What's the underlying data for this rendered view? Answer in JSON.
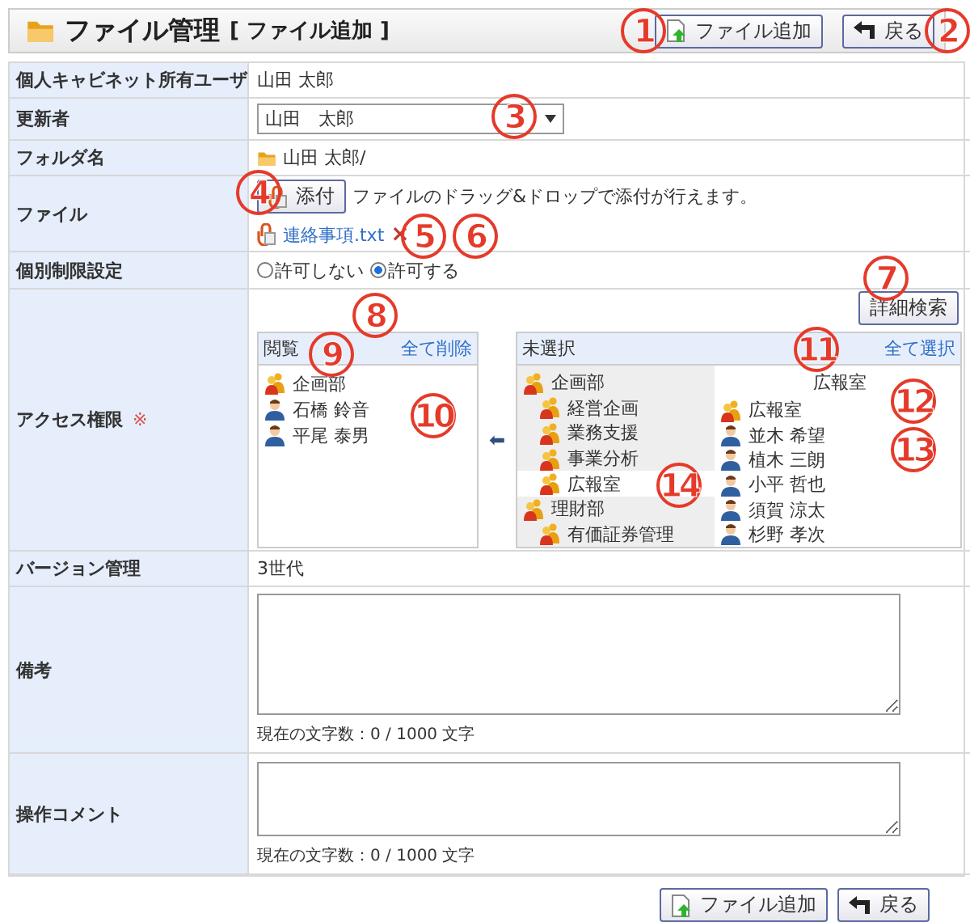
{
  "header": {
    "title": "ファイル管理",
    "subtitle": "[ ファイル追加 ]",
    "buttons": [
      {
        "kind": "add",
        "label": "ファイル追加"
      },
      {
        "kind": "back",
        "label": "戻る"
      }
    ]
  },
  "rows": [
    {
      "kind": "text",
      "label": "個人キャビネット所有ユーザ",
      "value": "山田 太郎"
    },
    {
      "kind": "select",
      "label": "更新者",
      "value": "山田　太郎"
    },
    {
      "kind": "folder",
      "label": "フォルダ名",
      "value": "山田 太郎/"
    },
    {
      "kind": "file",
      "label": "ファイル",
      "button": "添付",
      "hint": "ファイルのドラッグ&ドロップで添付が行えます。",
      "file": "連絡事項.txt",
      "remove": "×"
    },
    {
      "kind": "radio",
      "label": "個別制限設定",
      "options": [
        {
          "label": "許可しない",
          "selected": false
        },
        {
          "label": "許可する",
          "selected": true
        }
      ]
    },
    {
      "kind": "access",
      "label": "アクセス権限",
      "required": "※",
      "search": "詳細検索",
      "arrow": "⬅",
      "selected_panel": {
        "title": "閲覧",
        "action": "全て削除",
        "items": [
          {
            "kind": "group",
            "name": "企画部"
          },
          {
            "kind": "user",
            "name": "石橋 鈴音"
          },
          {
            "kind": "user",
            "name": "平尾 泰男"
          }
        ]
      },
      "unselected_panel": {
        "title": "未選択",
        "action": "全て選択",
        "tree": [
          {
            "name": "企画部",
            "selected": false,
            "children": [
              {
                "name": "経営企画",
                "selected": false
              },
              {
                "name": "業務支援",
                "selected": false
              },
              {
                "name": "事業分析",
                "selected": false
              },
              {
                "name": "広報室",
                "selected": true
              }
            ]
          },
          {
            "name": "理財部",
            "selected": false,
            "children": [
              {
                "name": "有価証券管理",
                "selected": false
              }
            ]
          }
        ],
        "members_title": "広報室",
        "members": [
          {
            "kind": "group",
            "name": "広報室"
          },
          {
            "kind": "user",
            "name": "並木 希望"
          },
          {
            "kind": "user",
            "name": "植木 三朗"
          },
          {
            "kind": "user",
            "name": "小平 哲也"
          },
          {
            "kind": "user",
            "name": "須賀 涼太"
          },
          {
            "kind": "user",
            "name": "杉野 孝次"
          }
        ]
      }
    },
    {
      "kind": "text",
      "label": "バージョン管理",
      "value": "3世代"
    },
    {
      "kind": "textarea",
      "label": "備考",
      "counter": "現在の文字数：0 /  1000  文字",
      "tall": true
    },
    {
      "kind": "textarea",
      "label": "操作コメント",
      "counter": "現在の文字数：0 /  1000  文字",
      "tall": false
    }
  ],
  "footer_buttons": [
    {
      "kind": "add",
      "label": "ファイル追加"
    },
    {
      "kind": "back",
      "label": "戻る"
    }
  ],
  "callouts": [
    "1",
    "2",
    "3",
    "4",
    "5",
    "6",
    "7",
    "8",
    "9",
    "10",
    "11",
    "12",
    "13",
    "14"
  ]
}
